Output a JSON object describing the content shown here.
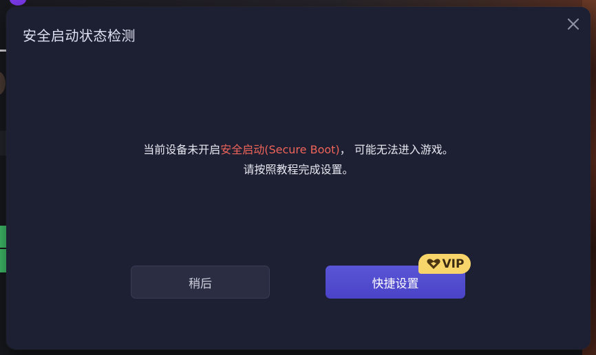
{
  "dialog": {
    "title": "安全启动状态检测",
    "message_line1_before": "当前设备未开启",
    "message_line1_highlight": "安全启动(Secure Boot)",
    "message_line1_after": "， 可能无法进入游戏。",
    "message_line2": "请按照教程完成设置。",
    "later_button": "稍后",
    "quick_setup_button": "快捷设置",
    "vip_badge": "VIP",
    "close_icon": "close-icon"
  },
  "colors": {
    "dialog_bg": "#1d1f32",
    "highlight": "#f0655a",
    "primary_button": "#4a43c8",
    "vip_badge": "#f7d56a"
  }
}
